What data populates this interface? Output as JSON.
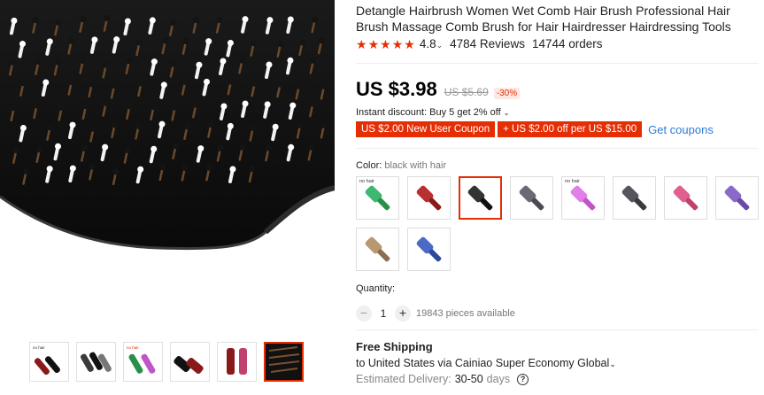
{
  "product": {
    "title": "Detangle Hairbrush Women Wet Comb Hair Brush Professional Hair Brush Massage Comb Brush for Hair Hairdresser Hairdressing Tools",
    "rating": "4.8",
    "rating_caret": "⌄",
    "reviews": "4784 Reviews",
    "orders": "14744 orders",
    "stars": 5
  },
  "price": {
    "current": "US $3.98",
    "original": "US $5.69",
    "discount": "-30%"
  },
  "discount": {
    "instant": "Instant discount: Buy 5 get 2% off",
    "caret": "⌄",
    "coupon1": "US $2.00 New User Coupon",
    "coupon2": "+ US $2.00 off per US $15.00",
    "get_coupons": "Get coupons"
  },
  "color": {
    "label": "Color:",
    "selected": "black with hair",
    "swatches": [
      {
        "tag": "no hair",
        "handle": "#2a8f4a",
        "bristle": "#3cb870"
      },
      {
        "tag": "",
        "handle": "#8a1a1a",
        "bristle": "#b83030"
      },
      {
        "tag": "",
        "handle": "#111111",
        "bristle": "#333333"
      },
      {
        "tag": "",
        "handle": "#4a4a52",
        "bristle": "#6a6a75"
      },
      {
        "tag": "no hair",
        "handle": "#c055c8",
        "bristle": "#e080e8"
      },
      {
        "tag": "",
        "handle": "#3a3a40",
        "bristle": "#555560"
      },
      {
        "tag": "",
        "handle": "#c04070",
        "bristle": "#e06090"
      },
      {
        "tag": "",
        "handle": "#6a4aa8",
        "bristle": "#8a6ac8"
      },
      {
        "tag": "",
        "handle": "#8a7050",
        "bristle": "#b89870"
      },
      {
        "tag": "",
        "handle": "#2a4a9a",
        "bristle": "#4a6ac8"
      }
    ],
    "selected_index": 2
  },
  "quantity": {
    "label": "Quantity:",
    "minus": "−",
    "value": "1",
    "plus": "+",
    "available": "19843 pieces available"
  },
  "shipping": {
    "title": "Free Shipping",
    "line": "to United States via Cainiao Super Economy Global",
    "caret": "⌄",
    "delivery_label": "Estimated Delivery:",
    "delivery_days": "30-50",
    "days_word": "days",
    "help": "?"
  },
  "gallery": {
    "thumb_tag": "no hair",
    "thumb_count": 6,
    "selected_thumb": 5
  },
  "colors": {
    "accent": "#e62e04",
    "link": "#2e7bd6",
    "star": "#e62e04"
  }
}
